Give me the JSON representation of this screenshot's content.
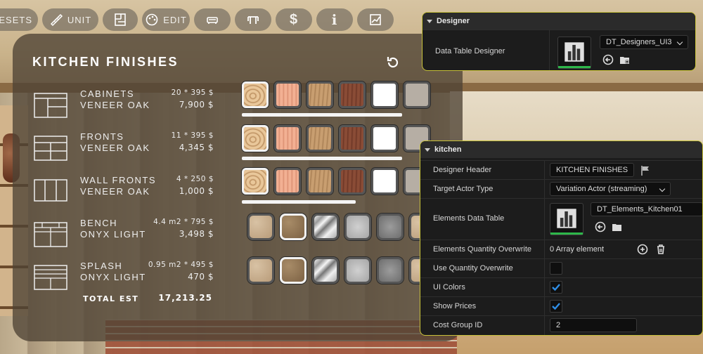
{
  "toolbar": {
    "presets_label": "RESETS",
    "unit_label": "UNIT",
    "edit_label": "EDIT",
    "price_glyph": "$",
    "info_glyph": "i"
  },
  "panel": {
    "title": "KITCHEN FINISHES",
    "rows": [
      {
        "name": "CABINETS",
        "material": "VENEER OAK",
        "calc": "20  * 395 $",
        "cost": "7,900 $"
      },
      {
        "name": "FRONTS",
        "material": "VENEER OAK",
        "calc": "11  * 395 $",
        "cost": "4,345 $"
      },
      {
        "name": "WALL FRONTS",
        "material": "VENEER OAK",
        "calc": "4  * 250 $",
        "cost": "1,000 $"
      },
      {
        "name": "BENCH",
        "material": "ONYX LIGHT",
        "calc": "4.4 m2 * 795 $",
        "cost": "3,498 $"
      },
      {
        "name": "SPLASH",
        "material": "ONYX LIGHT",
        "calc": "0.95 m2 * 495 $",
        "cost": "470 $"
      }
    ],
    "total_label": "TOTAL EST",
    "total_value": "17,213.25"
  },
  "designer_panel": {
    "header": "Designer",
    "label": "Data Table Designer",
    "value": "DT_Designers_UI3"
  },
  "kitchen_panel": {
    "header": "kitchen",
    "designer_header_label": "Designer Header",
    "designer_header_value": "KITCHEN FINISHES",
    "target_actor_label": "Target Actor Type",
    "target_actor_value": "Variation Actor (streaming)",
    "elements_table_label": "Elements Data Table",
    "elements_table_value": "DT_Elements_Kitchen01",
    "qty_overwrite_label": "Elements Quantity Overwrite",
    "qty_overwrite_value": "0 Array element",
    "use_qty_label": "Use Quantity Overwrite",
    "use_qty_checked": false,
    "ui_colors_label": "UI Colors",
    "ui_colors_checked": true,
    "show_prices_label": "Show Prices",
    "show_prices_checked": true,
    "cost_group_label": "Cost Group ID",
    "cost_group_value": "2"
  },
  "colors": {
    "panel_border": "#c7c13a",
    "check_blue": "#2f8ee6",
    "asset_green": "#2db84a"
  }
}
